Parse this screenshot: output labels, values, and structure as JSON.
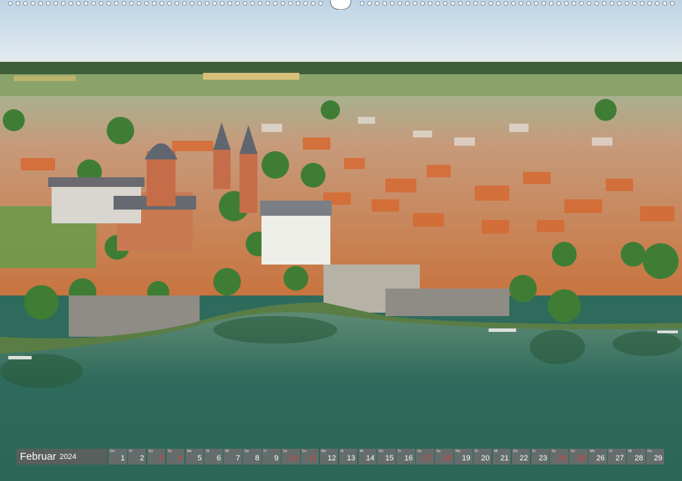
{
  "calendar": {
    "month": "Februar",
    "year": "2024",
    "days": [
      {
        "wd": "Do",
        "d": "1",
        "sun": false
      },
      {
        "wd": "Fr",
        "d": "2",
        "sun": false
      },
      {
        "wd": "Sa",
        "d": "3",
        "sun": true
      },
      {
        "wd": "So",
        "d": "4",
        "sun": true
      },
      {
        "wd": "Mo",
        "d": "5",
        "sun": false
      },
      {
        "wd": "Di",
        "d": "6",
        "sun": false
      },
      {
        "wd": "Mi",
        "d": "7",
        "sun": false
      },
      {
        "wd": "Do",
        "d": "8",
        "sun": false
      },
      {
        "wd": "Fr",
        "d": "9",
        "sun": false
      },
      {
        "wd": "Sa",
        "d": "10",
        "sun": true
      },
      {
        "wd": "So",
        "d": "11",
        "sun": true
      },
      {
        "wd": "Mo",
        "d": "12",
        "sun": false
      },
      {
        "wd": "Di",
        "d": "13",
        "sun": false
      },
      {
        "wd": "Mi",
        "d": "14",
        "sun": false
      },
      {
        "wd": "Do",
        "d": "15",
        "sun": false
      },
      {
        "wd": "Fr",
        "d": "16",
        "sun": false
      },
      {
        "wd": "Sa",
        "d": "17",
        "sun": true
      },
      {
        "wd": "So",
        "d": "18",
        "sun": true
      },
      {
        "wd": "Mo",
        "d": "19",
        "sun": false
      },
      {
        "wd": "Di",
        "d": "20",
        "sun": false
      },
      {
        "wd": "Mi",
        "d": "21",
        "sun": false
      },
      {
        "wd": "Do",
        "d": "22",
        "sun": false
      },
      {
        "wd": "Fr",
        "d": "23",
        "sun": false
      },
      {
        "wd": "Sa",
        "d": "24",
        "sun": true
      },
      {
        "wd": "So",
        "d": "25",
        "sun": true
      },
      {
        "wd": "Mo",
        "d": "26",
        "sun": false
      },
      {
        "wd": "Di",
        "d": "27",
        "sun": false
      },
      {
        "wd": "Mi",
        "d": "28",
        "sun": false
      },
      {
        "wd": "Do",
        "d": "29",
        "sun": false
      }
    ]
  },
  "colors": {
    "sky_top": "#c9dcea",
    "sky_bottom": "#e8eef2",
    "roof_orange": "#d8662f",
    "river": "#2f6b5c",
    "vegetation": "#4e8a3a"
  }
}
